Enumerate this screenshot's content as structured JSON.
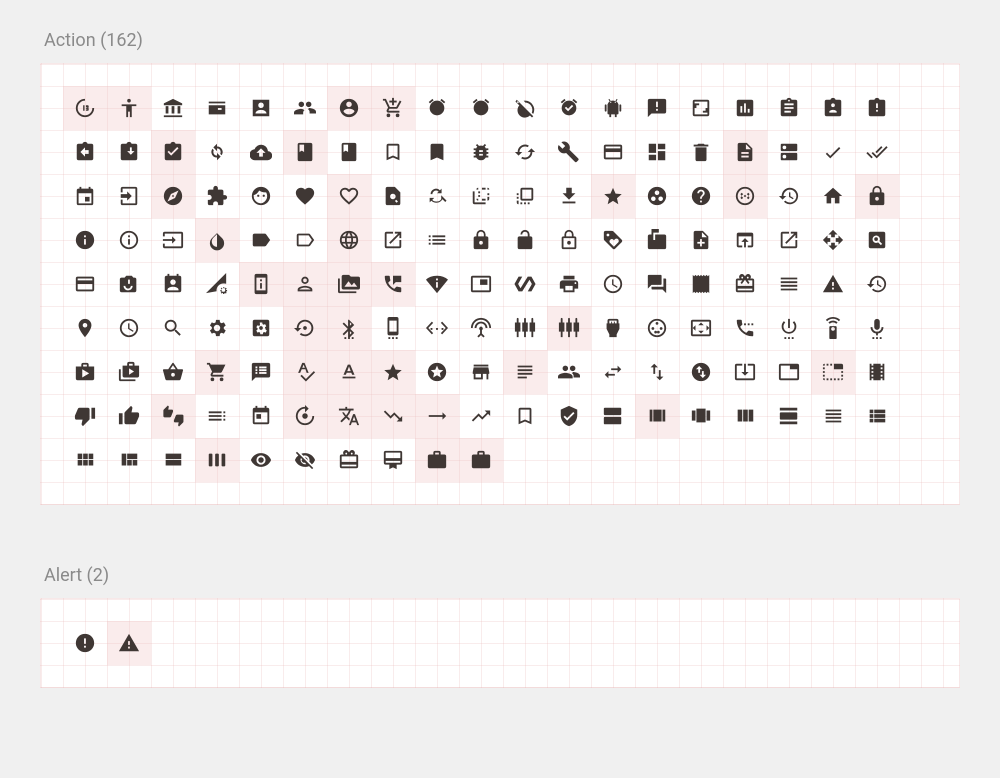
{
  "sections": [
    {
      "title_prefix": "Action",
      "count": 162,
      "icons": [
        "3d-rotation",
        "accessibility",
        "account-balance",
        "account-balance-wallet",
        "account-box",
        "supervisor-account",
        "account-circle",
        "add-shopping-cart",
        "alarm",
        "alarm-add",
        "alarm-off",
        "alarm-on",
        "android",
        "announcement",
        "aspect-ratio",
        "assessment",
        "assignment",
        "assignment-ind",
        "assignment-late",
        "assignment-return",
        "assignment-returned",
        "assignment-turned-in",
        "autorenew",
        "backup",
        "book",
        "class",
        "bookmark-border",
        "bookmark",
        "bug-report",
        "cached",
        "build",
        "credit-card",
        "dashboard",
        "delete",
        "description",
        "dns",
        "done",
        "done-all",
        "event",
        "exit-to-app",
        "explore",
        "extension",
        "face",
        "favorite",
        "favorite-border",
        "find-in-page",
        "find-replace",
        "flip-to-back",
        "flip-to-front",
        "get-app",
        "grade",
        "group-work",
        "help",
        "highlight-off",
        "history",
        "home",
        "https",
        "info",
        "info-outline",
        "input",
        "invert-colors",
        "label",
        "label-outline",
        "language",
        "launch",
        "list",
        "lock",
        "lock-open",
        "lock-outline",
        "loyalty",
        "markunread-mailbox",
        "note-add",
        "open-in-browser",
        "open-in-new",
        "open-with",
        "pageview",
        "payment",
        "perm-camera-mic",
        "perm-contact-calendar",
        "perm-data-setting",
        "perm-device-information",
        "perm-identity",
        "perm-media",
        "perm-phone-msg",
        "perm-scan-wifi",
        "picture-in-picture",
        "polymer",
        "print",
        "query-builder",
        "question-answer",
        "receipt",
        "redeem",
        "reorder",
        "report-problem",
        "restore",
        "room",
        "schedule",
        "search",
        "settings",
        "settings-applications",
        "settings-backup-restore",
        "settings-bluetooth",
        "settings-cell",
        "settings-ethernet",
        "settings-input-antenna",
        "settings-input-component",
        "settings-input-composite",
        "settings-input-hdmi",
        "settings-input-svideo",
        "settings-overscan",
        "settings-phone",
        "settings-power",
        "settings-remote",
        "settings-voice",
        "shop",
        "shop-two",
        "shopping-basket",
        "shopping-cart",
        "speaker-notes",
        "spellcheck",
        "text-format",
        "star-rate",
        "stars",
        "store",
        "subject",
        "supervisor-account-filled",
        "swap-horiz",
        "swap-vert",
        "swap-vertical-circle",
        "system-update-alt",
        "tab",
        "tab-unselected",
        "theaters",
        "thumb-down",
        "thumb-up",
        "thumbs-up-down",
        "toc",
        "today",
        "track-changes",
        "translate",
        "trending-down",
        "trending-flat",
        "trending-up",
        "turned-in-not",
        "verified-user",
        "view-agenda",
        "view-array",
        "view-carousel",
        "view-column",
        "view-day",
        "view-headline",
        "view-list",
        "view-module",
        "view-quilt",
        "view-stream",
        "view-week",
        "visibility",
        "visibility-off",
        "card-giftcard",
        "card-membership",
        "work",
        "work-filled"
      ],
      "highlighted": [
        0,
        1,
        6,
        7,
        21,
        24,
        34,
        40,
        44,
        50,
        53,
        56,
        60,
        63,
        80,
        81,
        82,
        83,
        100,
        101,
        106,
        117,
        119,
        120,
        121,
        124,
        131,
        135,
        138,
        139,
        140,
        141,
        146,
        155,
        160,
        161
      ]
    },
    {
      "title_prefix": "Alert",
      "count": 2,
      "icons": [
        "error",
        "warning"
      ],
      "highlighted": [
        1
      ]
    }
  ]
}
